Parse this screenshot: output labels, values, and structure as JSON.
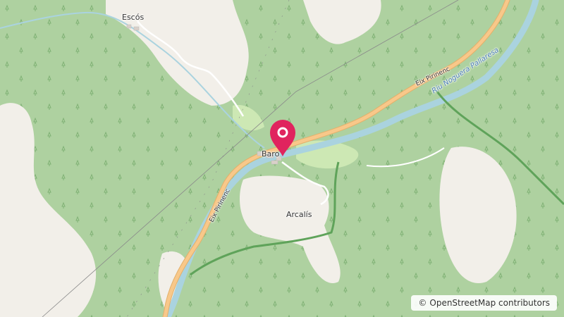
{
  "map": {
    "places": {
      "escos": "Escós",
      "baro": "Baro",
      "arcalis": "Arcalís"
    },
    "roads": {
      "eix_pirinenc_north": "Eix Pirinenc",
      "eix_pirinenc_south": "Eix Pirinenc"
    },
    "rivers": {
      "noguera_pallaresa": "Riu Noguera Pallaresa"
    },
    "marker": {
      "name": "map-pin-icon",
      "color": "#e0245e"
    },
    "attribution": {
      "symbol": "©",
      "text": "OpenStreetMap contributors"
    },
    "colors": {
      "forest": "#aed1a0",
      "open_land": "#f2efe9",
      "meadow": "#cde8b4",
      "road": "#f8c88a",
      "water": "#aad3df"
    }
  }
}
